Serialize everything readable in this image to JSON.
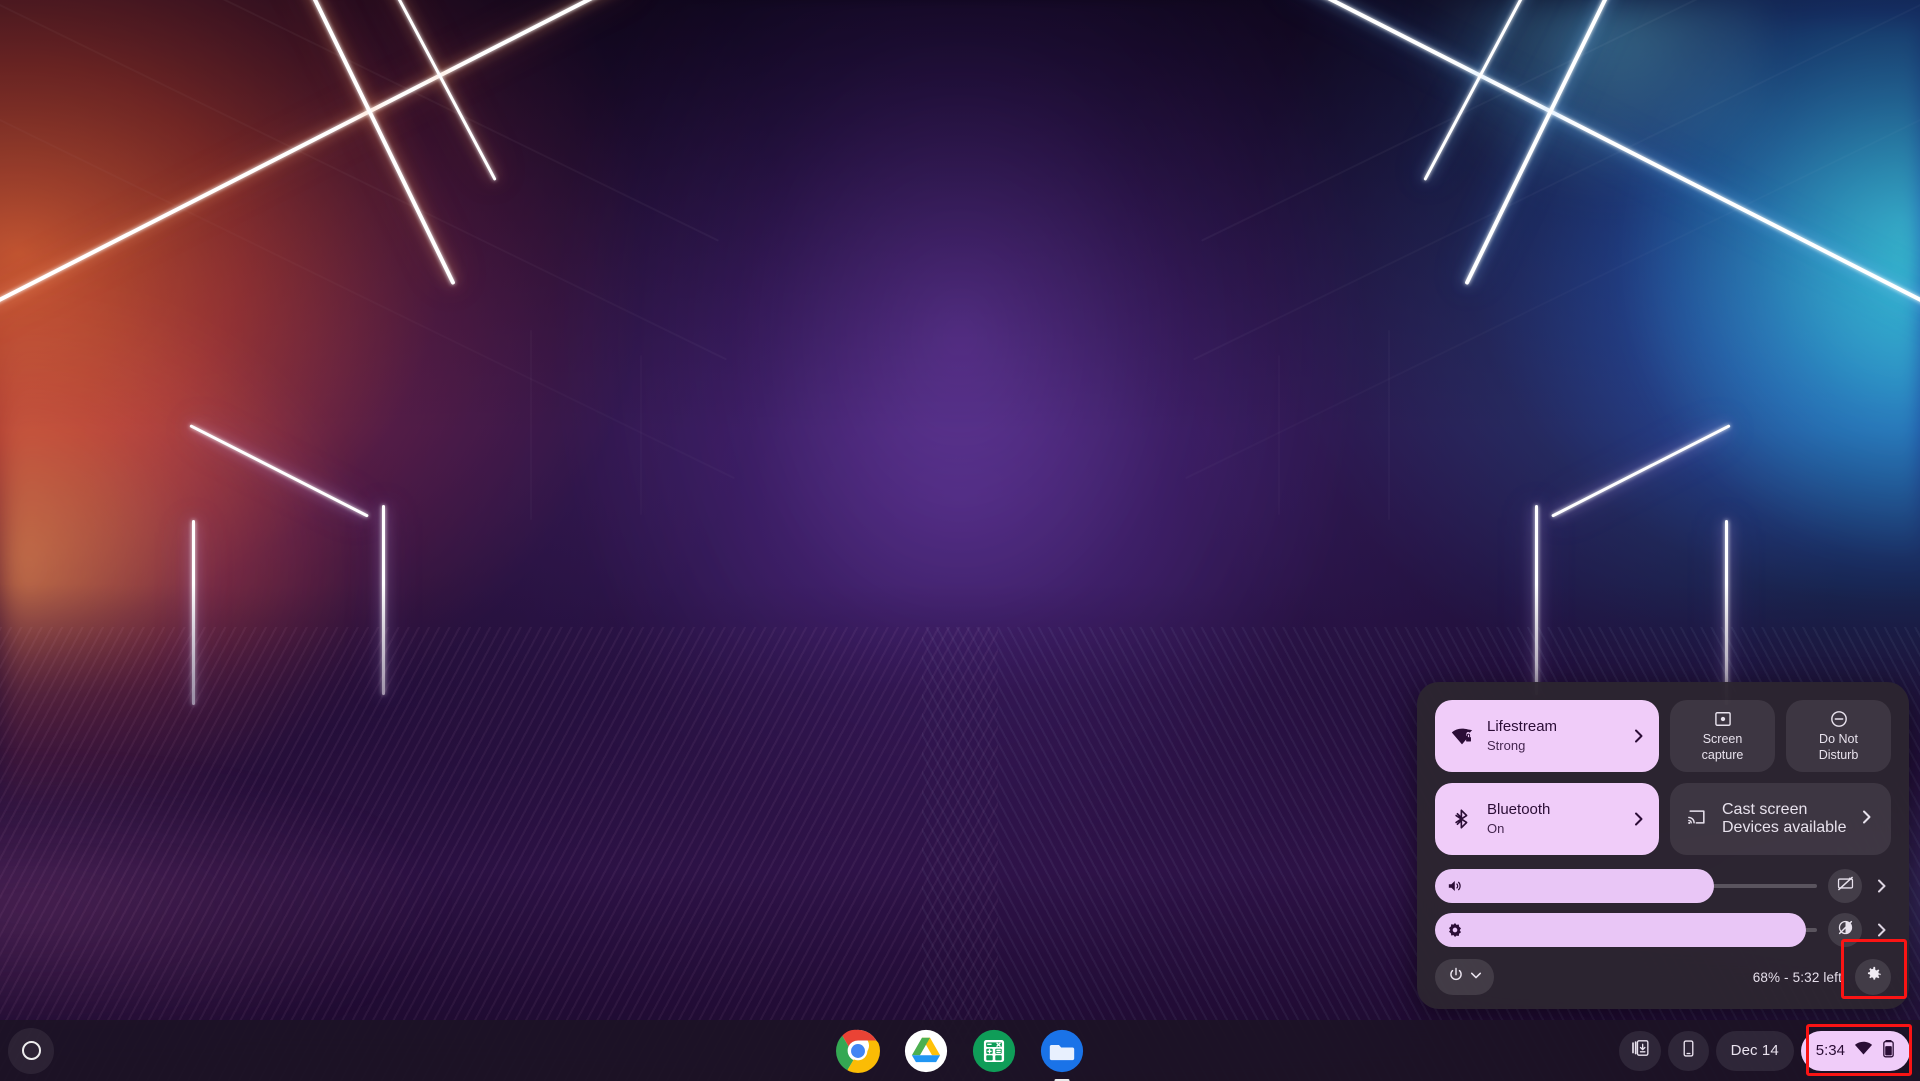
{
  "wallpaper": {
    "name": "neon-tunnel-wallpaper",
    "colors": {
      "left_glow": "#ff6c28",
      "right_glow": "#2896ff",
      "teal_glow": "#1ee6cd",
      "center": "#3a1f63",
      "floor": "#341450"
    }
  },
  "shelf": {
    "launcher_label": "Launcher",
    "apps": [
      {
        "name": "chrome",
        "label": "Google Chrome",
        "active": false
      },
      {
        "name": "drive",
        "label": "Google Drive",
        "active": false
      },
      {
        "name": "calculator",
        "label": "Calculator",
        "active": false
      },
      {
        "name": "files",
        "label": "Files",
        "active": true
      }
    ],
    "tray": {
      "tote_label": "Tote",
      "phone_hub_label": "Phone Hub",
      "date": "Dec 14",
      "time": "5:34",
      "wifi_label": "Wi-Fi connected",
      "battery_label": "Battery"
    }
  },
  "quick_settings": {
    "network_tile": {
      "title": "Lifestream",
      "subtitle": "Strong",
      "state": "on",
      "icon": "wifi-lock-icon",
      "chevron": "›"
    },
    "screen_capture_tile": {
      "label_line1": "Screen",
      "label_line2": "capture",
      "state": "off",
      "icon": "screen-capture-icon"
    },
    "do_not_disturb_tile": {
      "label_line1": "Do Not",
      "label_line2": "Disturb",
      "state": "off",
      "icon": "do-not-disturb-icon"
    },
    "bluetooth_tile": {
      "title": "Bluetooth",
      "subtitle": "On",
      "state": "on",
      "icon": "bluetooth-icon",
      "chevron": "›"
    },
    "cast_tile": {
      "title": "Cast screen",
      "subtitle": "Devices available",
      "state": "off",
      "icon": "cast-icon",
      "chevron": "›"
    },
    "volume_slider": {
      "label": "Volume",
      "value": 73,
      "icon": "volume-up-icon",
      "action_icon": "mic-off-icon",
      "chevron": "›"
    },
    "brightness_slider": {
      "label": "Brightness",
      "value": 97,
      "icon": "brightness-icon",
      "action_icon": "night-light-off-icon",
      "chevron": "›"
    },
    "power_button": {
      "label": "Power",
      "icon": "power-icon",
      "chevron_icon": "chevron-down-icon"
    },
    "battery_status": "68% - 5:32 left",
    "settings_button": {
      "label": "Settings",
      "icon": "gear-icon",
      "highlighted": true
    }
  },
  "annotations": {
    "highlight_color": "#fb1414",
    "boxes": [
      {
        "name": "settings-button-highlight"
      },
      {
        "name": "status-area-highlight"
      }
    ]
  }
}
